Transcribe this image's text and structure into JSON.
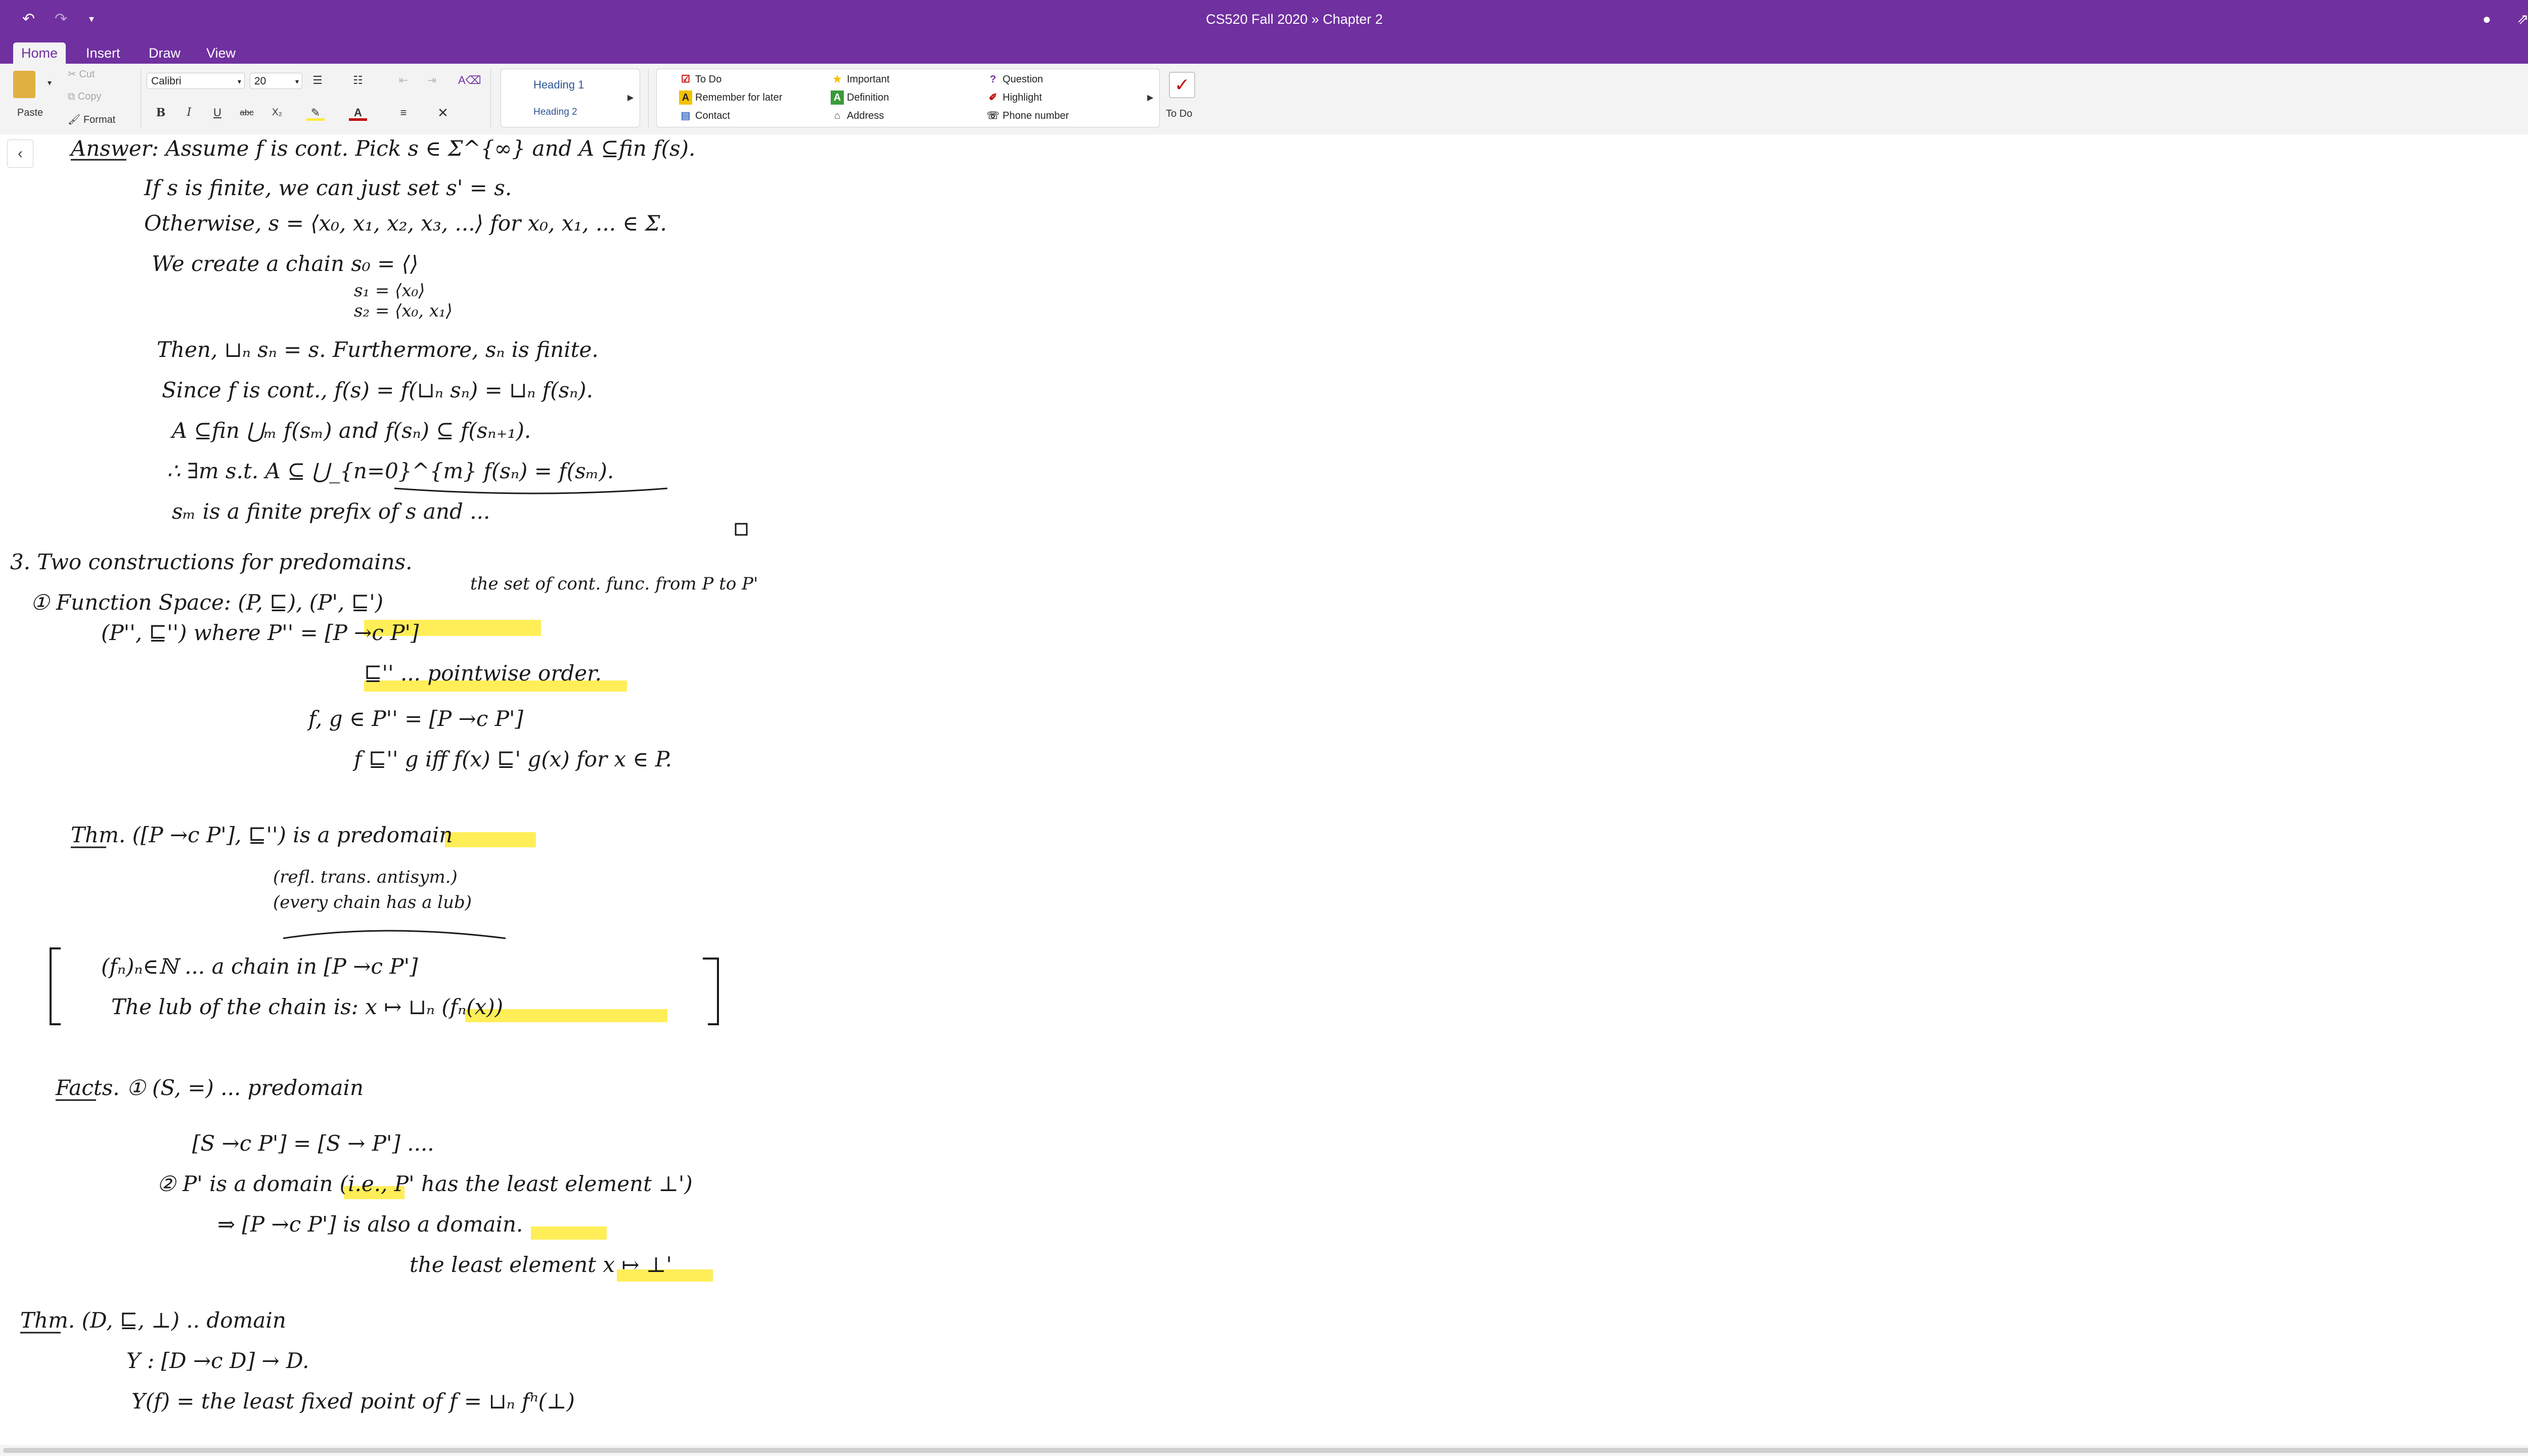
{
  "window": {
    "title": "CS520 Fall 2020  »  Chapter 2",
    "undo_icon": "undo-icon",
    "redo_icon": "redo-icon",
    "customize_icon": "chevron-down-icon",
    "right_icons": [
      "bell-icon",
      "share-icon",
      "expand-icon"
    ]
  },
  "tabs": [
    {
      "label": "Home",
      "active": true
    },
    {
      "label": "Insert",
      "active": false
    },
    {
      "label": "Draw",
      "active": false
    },
    {
      "label": "View",
      "active": false
    }
  ],
  "ribbon": {
    "clipboard": {
      "paste": "Paste",
      "cut": "Cut",
      "copy": "Copy",
      "format": "Format"
    },
    "font": {
      "family": "Calibri",
      "size": "20"
    },
    "format_buttons": [
      "B",
      "I",
      "U",
      "abc",
      "X₂"
    ],
    "styles": {
      "heading1": "Heading 1",
      "heading2": "Heading 2"
    },
    "tags": [
      {
        "label": "To Do",
        "icon": "checkbox-icon",
        "color": "#c00000"
      },
      {
        "label": "Remember for later",
        "icon": "highlight-a-icon",
        "color": "#f2c200"
      },
      {
        "label": "Contact",
        "icon": "contact-card-icon",
        "color": "#4472c4"
      },
      {
        "label": "Important",
        "icon": "star-icon",
        "color": "#f2c200"
      },
      {
        "label": "Definition",
        "icon": "green-a-icon",
        "color": "#3a9b3a"
      },
      {
        "label": "Address",
        "icon": "house-icon",
        "color": "#444444"
      },
      {
        "label": "Question",
        "icon": "question-icon",
        "color": "#7030a0"
      },
      {
        "label": "Highlight",
        "icon": "pen-icon",
        "color": "#c00000"
      },
      {
        "label": "Phone number",
        "icon": "phone-icon",
        "color": "#444444"
      }
    ],
    "todo_button": "To Do"
  },
  "notes": {
    "lines": [
      "Answer: Assume f is cont. Pick s ∈ Σ^{∞} and A ⊆fin f(s).",
      "If s is finite, we can just set s' = s.",
      "Otherwise, s = ⟨x₀, x₁, x₂, x₃, ...⟩ for x₀, x₁, ... ∈ Σ.",
      "We create a chain s₀ = ⟨⟩",
      "s₁ = ⟨x₀⟩",
      "s₂ = ⟨x₀, x₁⟩",
      "Then, ⊔ₙ sₙ = s. Furthermore, sₙ is finite.",
      "Since f is cont., f(s) = f(⊔ₙ sₙ) = ⊔ₙ f(sₙ).",
      "A ⊆fin ⋃ₘ f(sₘ) and f(sₙ) ⊆ f(sₙ₊₁).",
      "∴ ∃m s.t. A ⊆ ⋃_{n=0}^{m} f(sₙ) = f(sₘ).",
      "sₘ is a finite prefix of s and ...",
      "3. Two constructions for predomains.",
      "① Function Space: (P, ⊑), (P', ⊑')",
      "the set of cont. func. from P to P'",
      "(P'', ⊑'') where P'' = [P →c P']",
      "⊑'' ... pointwise order.",
      "f, g ∈ P'' = [P →c P']",
      "f ⊑'' g iff f(x) ⊑' g(x) for x ∈ P.",
      "Thm. ([P →c P'], ⊑'') is a predomain",
      "(refl. trans. antisym.)",
      "(every chain has a lub)",
      "(fₙ)ₙ∈ℕ ... a chain in [P →c P']",
      "The lub of the chain is: x ↦ ⊔ₙ (fₙ(x))",
      "Facts. ① (S, =) ... predomain",
      "[S →c P'] = [S → P'] ....",
      "② P' is a domain (i.e., P' has the least element ⊥')",
      "⇒ [P →c P'] is also a domain.",
      "the least element x ↦ ⊥'",
      "Thm. (D, ⊑, ⊥) .. domain",
      "Y : [D →c D] → D.",
      "Y(f) = the least fixed point of f = ⊔ₙ fⁿ(⊥)"
    ]
  },
  "colors": {
    "brand": "#7030a0",
    "ink": "#1a1a1a",
    "highlight": "#ffeb3b"
  }
}
